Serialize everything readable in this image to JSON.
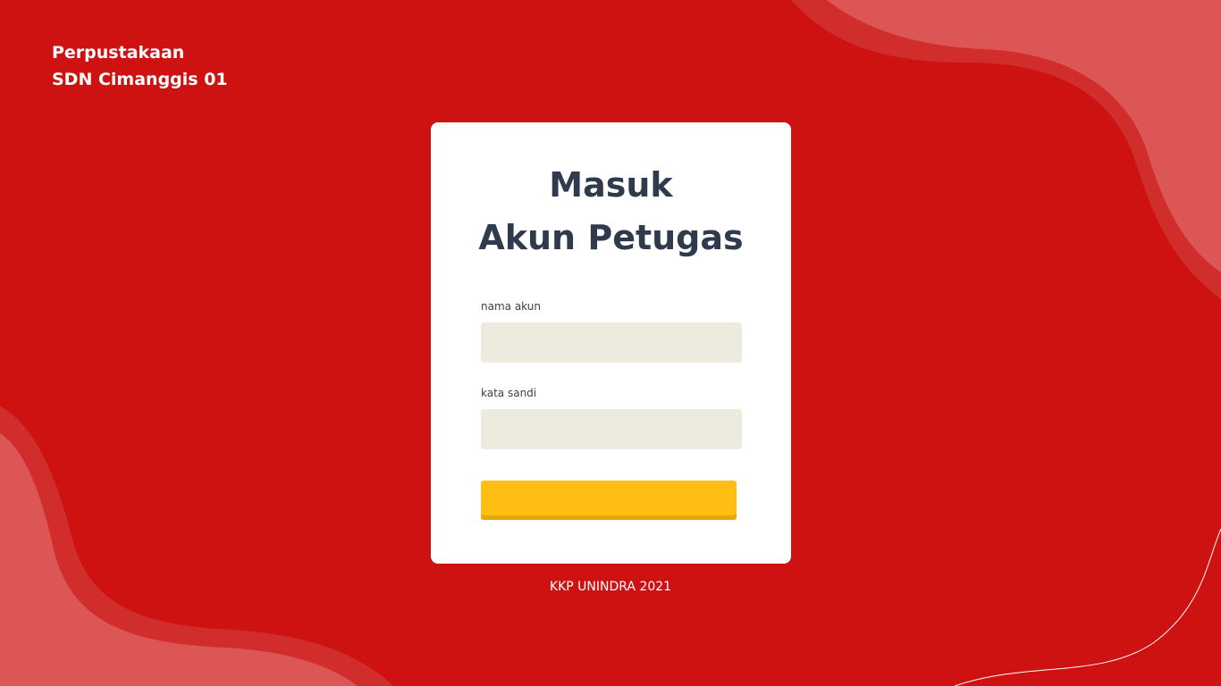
{
  "brand": {
    "line1": "Perpustakaan",
    "line2": "SDN Cimanggis 01"
  },
  "login": {
    "title_line1": "Masuk",
    "title_line2": "Akun Petugas",
    "username_label": "nama akun",
    "username_value": "",
    "password_label": "kata sandi",
    "password_value": "",
    "submit_label": ""
  },
  "footer": {
    "text": "KKP UNINDRA 2021"
  },
  "colors": {
    "background": "#ce1212",
    "blob": "#dd5656",
    "blob_border": "#d22d2d",
    "card": "#ffffff",
    "title": "#2f3a4d",
    "input_bg": "#edeade",
    "button": "#ffbe13",
    "button_shadow": "#e8a50c"
  }
}
